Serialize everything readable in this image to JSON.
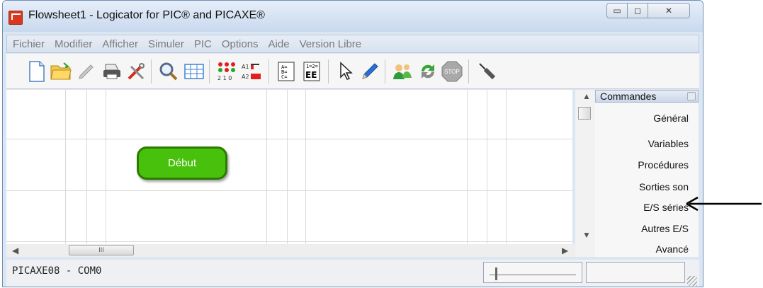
{
  "window": {
    "title": "Flowsheet1 - Logicator for PIC® and PICAXE®",
    "controls": {
      "minimize": "▭",
      "maximize": "◻",
      "close": "✕"
    }
  },
  "menu": [
    "Fichier",
    "Modifier",
    "Afficher",
    "Simuler",
    "PIC",
    "Options",
    "Aide",
    "Version Libre"
  ],
  "toolbar": {
    "icons": [
      "new-document-icon",
      "open-folder-icon",
      "edit-pen-icon",
      "print-icon",
      "tools-icon",
      "zoom-icon",
      "grid-icon",
      "outputs-icon",
      "inputs-icon",
      "variables-icon",
      "eeprom-icon",
      "pointer-icon",
      "pencil-icon",
      "users-icon",
      "refresh-icon",
      "stop-icon",
      "probe-icon"
    ],
    "stop_label": "STOP"
  },
  "canvas": {
    "start_block": "Début",
    "start_block_color": "#48c10d"
  },
  "scrollbar": {
    "thumb_label": "III"
  },
  "panel": {
    "title": "Commandes",
    "items": [
      "Général",
      "Variables",
      "Procédures",
      "Sorties son",
      "E/S séries",
      "Autres E/S",
      "Avancé"
    ]
  },
  "status": {
    "text": "PICAXE08 - COM0"
  }
}
